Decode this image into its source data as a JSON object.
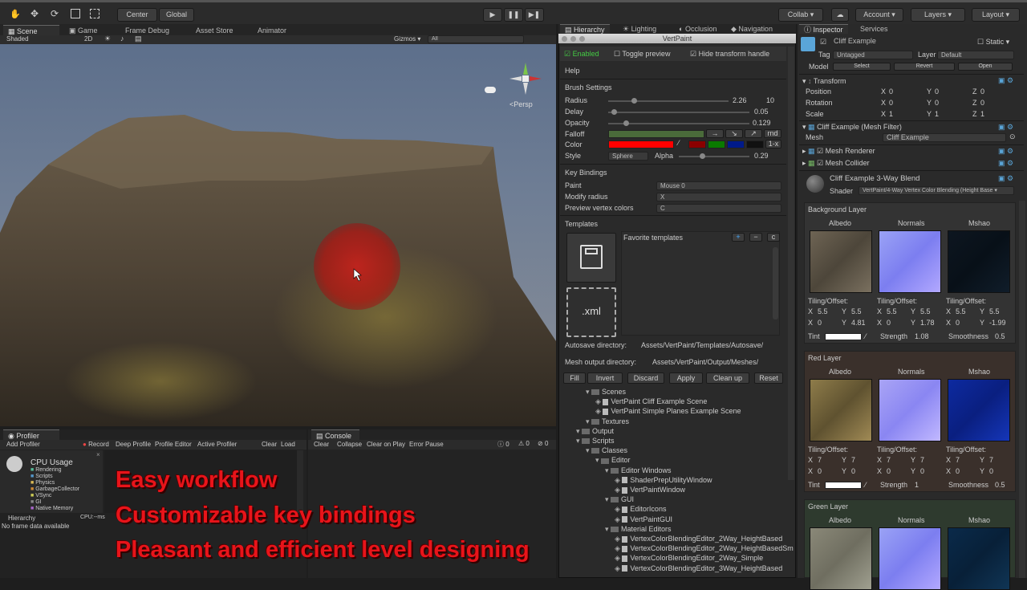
{
  "toolbar": {
    "center": "Center",
    "global": "Global",
    "collab": "Collab ▾",
    "account": "Account ▾",
    "layers": "Layers ▾",
    "layout": "Layout ▾"
  },
  "left_tabs": [
    "Scene",
    "Game",
    "Frame Debug",
    "Asset Store",
    "Animator"
  ],
  "scene_bar": {
    "shaded": "Shaded",
    "mode2d": "2D",
    "gizmos": "Gizmos ▾",
    "all": "All",
    "persp": "<Persp"
  },
  "mid_tabs": [
    "Hierarchy",
    "Lighting",
    "Occlusion",
    "Navigation"
  ],
  "vertpaint": {
    "title": "VertPaint",
    "enabled": "Enabled",
    "toggle_preview": "Toggle preview",
    "hide_handle": "Hide transform handle",
    "help": "Help",
    "brush_settings": "Brush Settings",
    "radius_label": "Radius",
    "radius_value": "2.26",
    "radius_max": "10",
    "delay_label": "Delay",
    "delay_value": "0.05",
    "opacity_label": "Opacity",
    "opacity_value": "0.129",
    "falloff_label": "Falloff",
    "falloff_rnd": "rnd",
    "color_label": "Color",
    "color_x": "1-x",
    "style_label": "Style",
    "style_value": "Sphere",
    "alpha_label": "Alpha",
    "alpha_value": "0.29",
    "key_bindings": "Key Bindings",
    "paint_label": "Paint",
    "paint_value": "Mouse 0",
    "modify_label": "Modify radius",
    "modify_value": "X",
    "preview_label": "Preview vertex colors",
    "preview_value": "C",
    "templates": "Templates",
    "fav_templates": "Favorite templates",
    "xml": ".xml",
    "autosave_label": "Autosave directory:",
    "autosave_value": "Assets/VertPaint/Templates/Autosave/",
    "mesh_out_label": "Mesh output directory:",
    "mesh_out_value": "Assets/VertPaint/Output/Meshes/",
    "buttons": [
      "Fill",
      "Invert",
      "Discard",
      "Apply",
      "Clean up",
      "Reset"
    ]
  },
  "hierarchy_tree": [
    {
      "label": "Scenes",
      "level": 0,
      "folder": true
    },
    {
      "label": "VertPaint Cliff Example Scene",
      "level": 1,
      "folder": false
    },
    {
      "label": "VertPaint Simple Planes Example Scene",
      "level": 1,
      "folder": false
    },
    {
      "label": "Textures",
      "level": 0,
      "folder": true
    },
    {
      "label": "Output",
      "level": -1,
      "folder": true
    },
    {
      "label": "Scripts",
      "level": -1,
      "folder": true
    },
    {
      "label": "Classes",
      "level": 0,
      "folder": true
    },
    {
      "label": "Editor",
      "level": 1,
      "folder": true
    },
    {
      "label": "Editor Windows",
      "level": 2,
      "folder": true
    },
    {
      "label": "ShaderPrepUtilityWindow",
      "level": 3,
      "folder": false
    },
    {
      "label": "VertPaintWindow",
      "level": 3,
      "folder": false
    },
    {
      "label": "GUI",
      "level": 2,
      "folder": true
    },
    {
      "label": "EditorIcons",
      "level": 3,
      "folder": false
    },
    {
      "label": "VertPaintGUI",
      "level": 3,
      "folder": false
    },
    {
      "label": "Material Editors",
      "level": 2,
      "folder": true
    },
    {
      "label": "VertexColorBlendingEditor_2Way_HeightBased",
      "level": 3,
      "folder": false
    },
    {
      "label": "VertexColorBlendingEditor_2Way_HeightBasedSm",
      "level": 3,
      "folder": false
    },
    {
      "label": "VertexColorBlendingEditor_2Way_Simple",
      "level": 3,
      "folder": false
    },
    {
      "label": "VertexColorBlendingEditor_3Way_HeightBased",
      "level": 3,
      "folder": false
    }
  ],
  "inspector": {
    "tab": "Inspector",
    "services": "Services",
    "object_name": "Cliff Example",
    "static": "Static ▾",
    "tag_label": "Tag",
    "tag_value": "Untagged",
    "layer_label": "Layer",
    "layer_value": "Default",
    "model_label": "Model",
    "model_buttons": [
      "Select",
      "Revert",
      "Open"
    ],
    "transform": "Transform",
    "rows": [
      {
        "label": "Position",
        "x": "0",
        "y": "0",
        "z": "0"
      },
      {
        "label": "Rotation",
        "x": "0",
        "y": "0",
        "z": "0"
      },
      {
        "label": "Scale",
        "x": "1",
        "y": "1",
        "z": "1"
      }
    ],
    "mesh_filter": "Cliff Example (Mesh Filter)",
    "mesh_label": "Mesh",
    "mesh_value": "Cliff Example",
    "mesh_renderer": "Mesh Renderer",
    "mesh_collider": "Mesh Collider",
    "material": "Cliff Example 3-Way Blend",
    "shader_label": "Shader",
    "shader_value": "VertPaint/4-Way Vertex Color Blending (Height Base ▾",
    "layers": [
      {
        "title": "Background Layer",
        "cols": [
          "Albedo",
          "Normals",
          "Mshao"
        ],
        "tiling": [
          [
            "5.5",
            "5.5",
            "0",
            "4.81"
          ],
          [
            "5.5",
            "5.5",
            "0",
            "1.78"
          ],
          [
            "5.5",
            "5.5",
            "0",
            "-1.99"
          ]
        ],
        "strength": "1.08",
        "smoothness": "0.5"
      },
      {
        "title": "Red Layer",
        "cols": [
          "Albedo",
          "Normals",
          "Mshao"
        ],
        "tiling": [
          [
            "7",
            "7",
            "0",
            "0"
          ],
          [
            "7",
            "7",
            "0",
            "0"
          ],
          [
            "7",
            "7",
            "0",
            "0"
          ]
        ],
        "strength": "1",
        "smoothness": "0.5"
      },
      {
        "title": "Green Layer",
        "cols": [
          "Albedo",
          "Normals",
          "Mshao"
        ]
      }
    ],
    "tiling_label": "Tiling/Offset:",
    "tint_label": "Tint",
    "strength_label": "Strength",
    "smoothness_label": "Smoothness"
  },
  "profiler": {
    "tab": "Profiler",
    "add": "Add Profiler",
    "record": "Record",
    "deep": "Deep Profile",
    "editor": "Profile Editor",
    "active": "Active Profiler",
    "clear": "Clear",
    "load": "Load",
    "cpu": "CPU Usage",
    "items": [
      "Rendering",
      "Scripts",
      "Physics",
      "GarbageCollector",
      "VSync",
      "GI",
      "Native Memory"
    ],
    "hierarchy": "Hierarchy",
    "cpu_ms": "CPU:--ms",
    "no_data": "No frame data available"
  },
  "console": {
    "tab": "Console",
    "clear": "Clear",
    "collapse": "Collapse",
    "clear_on_play": "Clear on Play",
    "error_pause": "Error Pause",
    "counts": [
      "0",
      "0",
      "0"
    ]
  },
  "overlay": [
    "Easy workflow",
    "Customizable key bindings",
    "Pleasant and efficient level designing"
  ]
}
